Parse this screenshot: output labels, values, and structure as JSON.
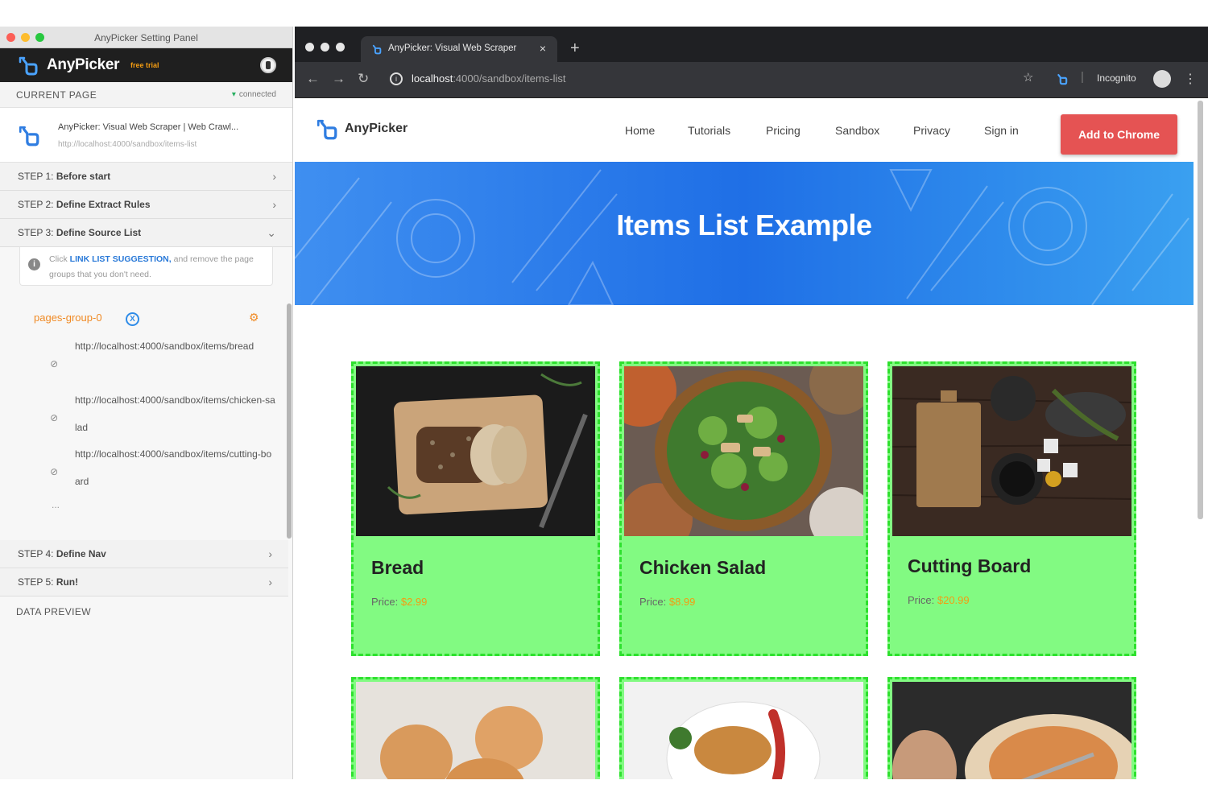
{
  "panel": {
    "window_title": "AnyPicker Setting Panel",
    "brand": "AnyPicker",
    "trial": "free trial",
    "current_page": {
      "label": "CURRENT PAGE",
      "status": "connected",
      "title": "AnyPicker: Visual Web Scraper | Web Crawl...",
      "url": "http://localhost:4000/sandbox/items-list"
    },
    "steps": [
      {
        "prefix": "STEP 1:",
        "label": "Before start"
      },
      {
        "prefix": "STEP 2:",
        "label": "Define Extract Rules"
      },
      {
        "prefix": "STEP 3:",
        "label": "Define Source List"
      },
      {
        "prefix": "STEP 4:",
        "label": "Define Nav"
      },
      {
        "prefix": "STEP 5:",
        "label": "Run!"
      }
    ],
    "hint": {
      "pre": "Click",
      "link": "LINK LIST SUGGESTION,",
      "post": "and remove the page groups that you don't need."
    },
    "group": {
      "name": "pages-group-0",
      "badge": "X",
      "urls": [
        "http://localhost:4000/sandbox/items/bread",
        "http://localhost:4000/sandbox/items/chicken-salad",
        "http://localhost:4000/sandbox/items/cutting-board"
      ],
      "more": "..."
    },
    "data_preview": "DATA PREVIEW"
  },
  "browser": {
    "tab_title": "AnyPicker: Visual Web Scraper",
    "url_host": "localhost",
    "url_path": ":4000/sandbox/items-list",
    "incognito": "Incognito"
  },
  "site": {
    "name": "AnyPicker",
    "nav": [
      "Home",
      "Tutorials",
      "Pricing",
      "Sandbox",
      "Privacy",
      "Sign in"
    ],
    "cta": "Add to Chrome",
    "hero_title": "Items List Example",
    "price_label": "Price:",
    "items": [
      {
        "name": "Bread",
        "price": "$2.99"
      },
      {
        "name": "Chicken Salad",
        "price": "$8.99"
      },
      {
        "name": "Cutting Board",
        "price": "$20.99"
      }
    ]
  },
  "colors": {
    "accent_blue": "#1f6fe6",
    "cta_red": "#e55353",
    "highlight_green": "#82fa82",
    "price_orange": "#f39c12",
    "group_orange": "#f08a24"
  }
}
